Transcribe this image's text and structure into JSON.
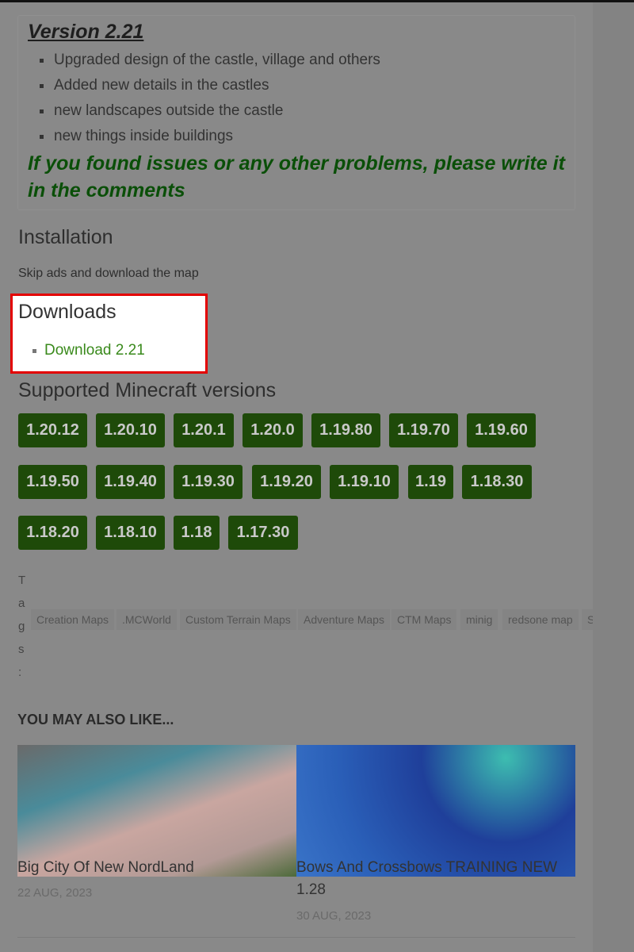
{
  "changelog": {
    "version_title": "Version 2.21",
    "notes": [
      "Upgraded design of the castle, village and others",
      "Added new details in the castles",
      "new landscapes outside the castle",
      "new things inside buildings"
    ],
    "warning": "If you found issues or any other problems, please write it in the comments"
  },
  "installation": {
    "heading": "Installation",
    "text": "Skip ads and download the map"
  },
  "downloads": {
    "heading": "Downloads",
    "link": "Download 2.21"
  },
  "supported": {
    "heading": "Supported Minecraft versions",
    "versions": [
      "1.20.12",
      "1.20.10",
      "1.20.1",
      "1.20.0",
      "1.19.80",
      "1.19.70",
      "1.19.60",
      "1.19.50",
      "1.19.40",
      "1.19.30",
      "1.19.20",
      "1.19.10",
      "1.19",
      "1.18.30",
      "1.18.20",
      "1.18.10",
      "1.18",
      "1.17.30"
    ]
  },
  "tags": {
    "label": [
      "T",
      "a",
      "g",
      "s",
      ":"
    ],
    "items": [
      "Creation Maps",
      ".MCWorld",
      "Custom Terrain Maps",
      "Adventure Maps",
      "CTM Maps",
      "minig",
      "redsone map",
      "S"
    ]
  },
  "related": {
    "heading": "YOU MAY ALSO LIKE...",
    "cards": [
      {
        "title": "Big City Of New NordLand",
        "date": "22 AUG, 2023"
      },
      {
        "title": "Bows And Crossbows TRAINING NEW",
        "title_line2": "1.28",
        "date": "30 AUG, 2023"
      }
    ]
  },
  "colors": {
    "button": "#1e4a09",
    "highlight_border": "#e30000",
    "link": "#3a8a1c",
    "warning": "#0a4f08"
  }
}
